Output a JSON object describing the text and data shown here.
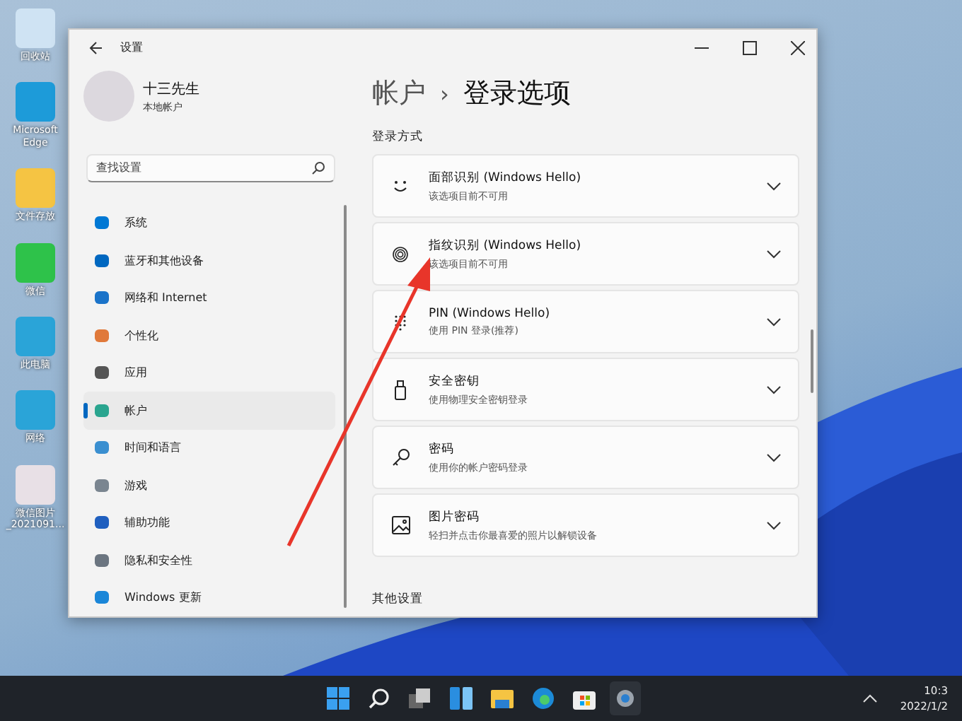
{
  "desktop_icons": [
    {
      "label": "回收站"
    },
    {
      "label": "Microsoft Edge"
    },
    {
      "label": "文件存放"
    },
    {
      "label": "微信"
    },
    {
      "label": "此电脑"
    },
    {
      "label": "网络"
    },
    {
      "label": "微信图片_2021091..."
    }
  ],
  "window": {
    "title": "设置"
  },
  "profile": {
    "name": "十三先生",
    "account_type": "本地帐户"
  },
  "search": {
    "placeholder": "查找设置"
  },
  "sidebar": {
    "items": [
      {
        "label": "系统",
        "selected": false
      },
      {
        "label": "蓝牙和其他设备",
        "selected": false
      },
      {
        "label": "网络和 Internet",
        "selected": false
      },
      {
        "label": "个性化",
        "selected": false
      },
      {
        "label": "应用",
        "selected": false
      },
      {
        "label": "帐户",
        "selected": true
      },
      {
        "label": "时间和语言",
        "selected": false
      },
      {
        "label": "游戏",
        "selected": false
      },
      {
        "label": "辅助功能",
        "selected": false
      },
      {
        "label": "隐私和安全性",
        "selected": false
      },
      {
        "label": "Windows 更新",
        "selected": false
      }
    ]
  },
  "breadcrumb": {
    "parent": "帐户",
    "separator": "›",
    "current": "登录选项"
  },
  "section_title": "登录方式",
  "options": [
    {
      "title": "面部识别 (Windows Hello)",
      "subtitle": "该选项目前不可用"
    },
    {
      "title": "指纹识别 (Windows Hello)",
      "subtitle": "该选项目前不可用"
    },
    {
      "title": "PIN (Windows Hello)",
      "subtitle": "使用 PIN 登录(推荐)"
    },
    {
      "title": "安全密钥",
      "subtitle": "使用物理安全密钥登录"
    },
    {
      "title": "密码",
      "subtitle": "使用你的帐户密码登录"
    },
    {
      "title": "图片密码",
      "subtitle": "轻扫并点击你最喜爱的照片以解锁设备"
    }
  ],
  "other_section_title": "其他设置",
  "taskbar": {
    "time": "10:3",
    "date": "2022/1/2"
  }
}
